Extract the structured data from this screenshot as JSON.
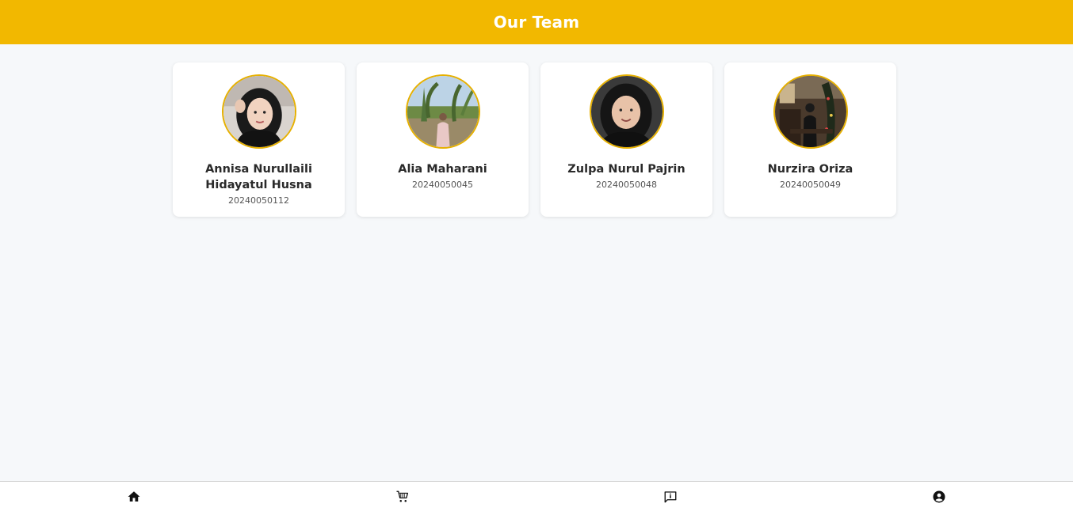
{
  "header": {
    "title": "Our Team"
  },
  "colors": {
    "accent": "#f2b800",
    "background": "#f6f8fa",
    "card": "#ffffff"
  },
  "team": [
    {
      "name": "Annisa Nurullaili Hidayatul Husna",
      "id": "20240050112",
      "photo": "avatar-photo"
    },
    {
      "name": "Alia Maharani",
      "id": "20240050045",
      "photo": "avatar-photo"
    },
    {
      "name": "Zulpa Nurul Pajrin",
      "id": "20240050048",
      "photo": "avatar-photo"
    },
    {
      "name": "Nurzira Oriza",
      "id": "20240050049",
      "photo": "avatar-photo"
    }
  ],
  "bottom_nav": [
    {
      "icon": "home-icon"
    },
    {
      "icon": "cart-icon"
    },
    {
      "icon": "info-message-icon"
    },
    {
      "icon": "account-circle-icon"
    }
  ]
}
